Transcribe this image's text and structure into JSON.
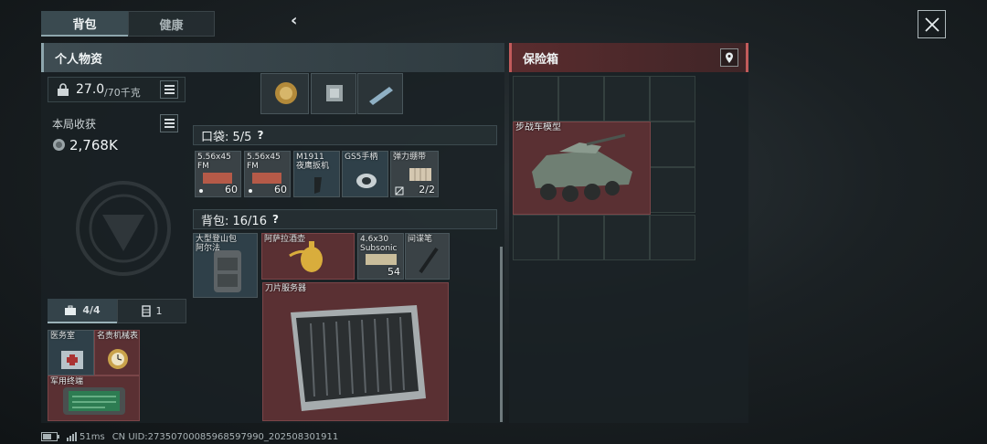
{
  "tabs": [
    {
      "label": "背包",
      "active": true
    },
    {
      "label": "健康",
      "active": false
    }
  ],
  "personal": {
    "title": "个人物资",
    "weight_value": "27.0",
    "weight_max": "/70千克",
    "harvest_label": "本局收获",
    "harvest_value": "2,768K",
    "container_tab_count": "4/4",
    "container_tab2_count": "1"
  },
  "pocket": {
    "label": "口袋: 5/5",
    "help": "?"
  },
  "backpack": {
    "label": "背包: 16/16",
    "help": "?"
  },
  "pocket_items": [
    {
      "name": "5.56x45\nFM",
      "count": "60"
    },
    {
      "name": "5.56x45\nFM",
      "count": "60"
    },
    {
      "name": "M1911\n夜鹰扳机",
      "count": ""
    },
    {
      "name": "GS5手柄",
      "count": ""
    },
    {
      "name": "弹力绷带",
      "count": "2/2"
    }
  ],
  "backpack_items": [
    {
      "name": "大型登山包\n阿尔法"
    },
    {
      "name": "阿萨拉酒壶"
    },
    {
      "name": "4.6x30\nSubsonic",
      "count": "54"
    },
    {
      "name": "间谍笔"
    },
    {
      "name": "刀片服务器"
    }
  ],
  "secure_items": [
    {
      "name": "医务室"
    },
    {
      "name": "名贵机械表"
    },
    {
      "name": "军用终端"
    }
  ],
  "safe": {
    "title": "保险箱",
    "item_name": "步战车模型"
  },
  "status": {
    "ping": "51ms",
    "uid": "CN UID:27350700085968597990_202508301911"
  },
  "colors": {
    "accent": "#8ea6ad",
    "safe_red": "#c25b5b",
    "item_red": "#5a3033"
  }
}
